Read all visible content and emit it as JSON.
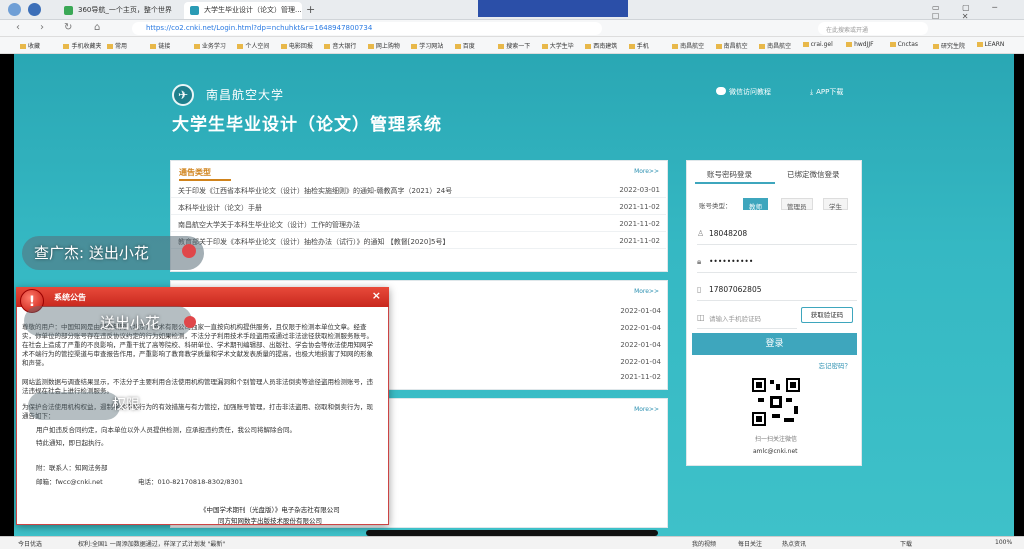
{
  "browser": {
    "tabs": [
      {
        "label": "360导航_一个主页，整个世界"
      },
      {
        "label": "大学生毕业设计（论文）管理..."
      }
    ],
    "url": "https://co2.cnki.net/Login.html?dp=nchuhkt&r=1648947800734",
    "search_placeholder": "在此搜索或开通",
    "bookmarks": [
      "收藏",
      "手机收藏夹",
      "常用",
      "链接",
      "业务学习",
      "个人空间",
      "电影回报",
      "音大银行",
      "网上购物",
      "学习网站",
      "百度",
      "搜索一下",
      "大学生毕",
      "西南建筑",
      "手机",
      "南昌航空",
      "南昌航空",
      "南昌航空",
      "crai.gel",
      "hwdJJF",
      "Cnctas",
      "研究生院",
      "LEARN"
    ]
  },
  "header": {
    "university": "南昌航空大学",
    "system_title": "大学生毕业设计（论文）管理系统",
    "wechat_link": "微信访问教程",
    "app_link": "APP下载"
  },
  "notices": {
    "title": "通告类型",
    "more": "More>>",
    "items": [
      {
        "title": "关于印发《江西省本科毕业论文（设计）抽检实施细则》的通知-赣教高字（2021）24号",
        "date": "2022-03-01"
      },
      {
        "title": "本科毕业设计（论文）手册",
        "date": "2021-11-02"
      },
      {
        "title": "南昌航空大学关于本科生毕业论文（设计）工作的管理办法",
        "date": "2021-11-02"
      },
      {
        "title": "教育部关于印发《本科毕业论文（设计）抽检办法（试行）》的通知 【教督[2020]5号】",
        "date": "2021-11-02"
      }
    ]
  },
  "panel2": {
    "more": "More>>",
    "dates": [
      "2022-01-04",
      "2022-01-04",
      "2022-01-04",
      "2022-01-04",
      "2021-11-02"
    ]
  },
  "panel3": {
    "more": "More>>"
  },
  "login": {
    "tab_password": "账号密码登录",
    "tab_wechat": "已绑定微信登录",
    "role_label": "账号类型：",
    "roles": [
      "教师",
      "管理员",
      "学生"
    ],
    "username": "18048208",
    "password": "••••••••••",
    "phone": "17807062805",
    "code_placeholder": "请输入手机验证码",
    "get_code": "获取验证码",
    "submit": "登录",
    "forgot": "忘记密码？",
    "qr_caption": "扫一扫关注微信",
    "email": "amlc@cnki.net"
  },
  "popup": {
    "title": "系统公告",
    "close": "×",
    "para1": "尊敬的用户：中国知网是由同方知网（北京）技术有限公司独家一直按向机构提供服务，且仅限于检测本单位文章。经查实，你单位的部分账号存在违反协议约定的行为如果检测，不法分子利用技术手段盗用或通过非法途径获取检测服务账号。在社会上造成了严重的不良影响，严重干扰了高等院校、科研单位、学术期刊编辑部、出版社、学会协会等依法使用知网学术不端行为的管控渠道与审查报告作用，严重影响了教育教学质量和学术文献发表质量的提高，也极大地损害了知网的形象和声誉。",
    "para2": "网站监测数据与调查结果显示，不法分子主要利用合法使用机构管理漏洞和个别管理人员非法倒卖等途径盗用检测账号，违法违规在社会上进行检测服务。",
    "para3": "为保护合法使用机构权益，遏制学术不端行为的有效措施与有力管控，加强账号管理，打击非法盗用、窃取和倒卖行为，现通告如下：",
    "para4": "用户如违反合同约定，向本单位以外人员提供检测，应承担违约责任，我公司将解除合同。",
    "para5": "特此通知，即日起执行。",
    "contact_label": "附：联系人：知网法务部",
    "email_label": "邮箱：fwcc@cnki.net",
    "phone_label": "电话：010-82170818-8302/8301",
    "sign1": "《中国学术期刊（光盘版）》电子杂志社有限公司",
    "sign2": "同方知网数字出版技术股份有限公司"
  },
  "overlays": {
    "msg1": "查广杰: 送出小花",
    "msg2": "送出小花",
    "msg3": "权限"
  },
  "statusbar": {
    "left": "今日优选",
    "news": "权利:全国1 一周添加数据通过，样深了式计划发 \"最新\"",
    "right": [
      "我的视频",
      "每日关注",
      "热点资讯",
      "下载",
      "100%"
    ]
  },
  "colors": {
    "page_bg": "#35b8c3",
    "accent": "#3ea6bd",
    "popup_red": "#d03025",
    "notice_title": "#d0831b"
  }
}
